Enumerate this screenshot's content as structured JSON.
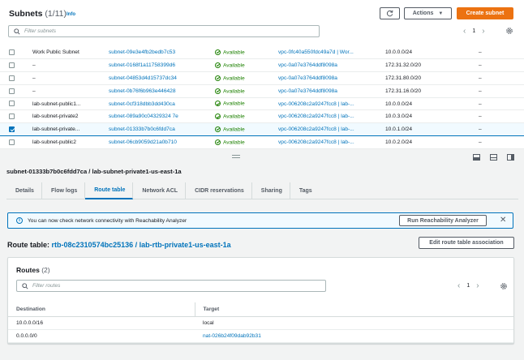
{
  "header": {
    "title": "Subnets",
    "count": "(1/11)",
    "info_link": "Info",
    "actions_label": "Actions",
    "create_label": "Create subnet",
    "refresh_icon": "refresh-icon"
  },
  "search": {
    "placeholder": "Filter subnets"
  },
  "pagination": {
    "page": "1"
  },
  "subnets": [
    {
      "name": "Work Public Subnet",
      "id": "subnet-09e3e4fb2bedb7c53",
      "state": "Available",
      "vpc": "vpc-0fc40a550fdc49a7d | Wor...",
      "cidr": "10.0.0.0/24",
      "ipv6": "–",
      "selected": false
    },
    {
      "name": "–",
      "id": "subnet-0168f1a11758399d6",
      "state": "Available",
      "vpc": "vpc-0a07e3764ddf8098a",
      "cidr": "172.31.32.0/20",
      "ipv6": "–",
      "selected": false
    },
    {
      "name": "–",
      "id": "subnet-04853d4d15737dc34",
      "state": "Available",
      "vpc": "vpc-0a07e3764ddf8098a",
      "cidr": "172.31.80.0/20",
      "ipv6": "–",
      "selected": false
    },
    {
      "name": "–",
      "id": "subnet-0b76f6b963e446428",
      "state": "Available",
      "vpc": "vpc-0a07e3764ddf8098a",
      "cidr": "172.31.16.0/20",
      "ipv6": "–",
      "selected": false
    },
    {
      "name": "lab-subnet-public1...",
      "id": "subnet-0cf318dbb3dd430ca",
      "state": "Available",
      "vpc": "vpc-006208c2a9247fcc8 | lab-...",
      "cidr": "10.0.0.0/24",
      "ipv6": "–",
      "selected": false
    },
    {
      "name": "lab-subnet-private2",
      "id": "subnet-089a90c04329324 7e",
      "state": "Available",
      "vpc": "vpc-006208c2a9247fcc8 | lab-...",
      "cidr": "10.0.3.0/24",
      "ipv6": "–",
      "selected": false
    },
    {
      "name": "lab-subnet-private...",
      "id": "subnet-01333b7b0c6fdd7ca",
      "state": "Available",
      "vpc": "vpc-006208c2a9247fcc8 | lab-...",
      "cidr": "10.0.1.0/24",
      "ipv6": "–",
      "selected": true
    },
    {
      "name": "lab-subnet-public2",
      "id": "subnet-06cb9059d21a0b710",
      "state": "Available",
      "vpc": "vpc-006208c2a9247fcc8 | lab-...",
      "cidr": "10.0.2.0/24",
      "ipv6": "–",
      "selected": false
    }
  ],
  "detail": {
    "title": "subnet-01333b7b0c6fdd7ca / lab-subnet-private1-us-east-1a",
    "tabs": [
      "Details",
      "Flow logs",
      "Route table",
      "Network ACL",
      "CIDR reservations",
      "Sharing",
      "Tags"
    ],
    "active_tab": "Route table"
  },
  "flash": {
    "message": "You can now check network connectivity with Reachability Analyzer",
    "button": "Run Reachability Analyzer"
  },
  "route_table": {
    "label": "Route table:",
    "link": "rtb-08c2310574bc25136 / lab-rtb-private1-us-east-1a",
    "edit_button": "Edit route table association"
  },
  "routes": {
    "title": "Routes",
    "count": "(2)",
    "search_placeholder": "Filter routes",
    "page": "1",
    "columns": [
      "Destination",
      "Target"
    ],
    "rows": [
      {
        "destination": "10.0.0.0/16",
        "target": "local",
        "target_is_link": false
      },
      {
        "destination": "0.0.0.0/0",
        "target": "nat-026b24f09dab92b31",
        "target_is_link": true
      }
    ]
  }
}
